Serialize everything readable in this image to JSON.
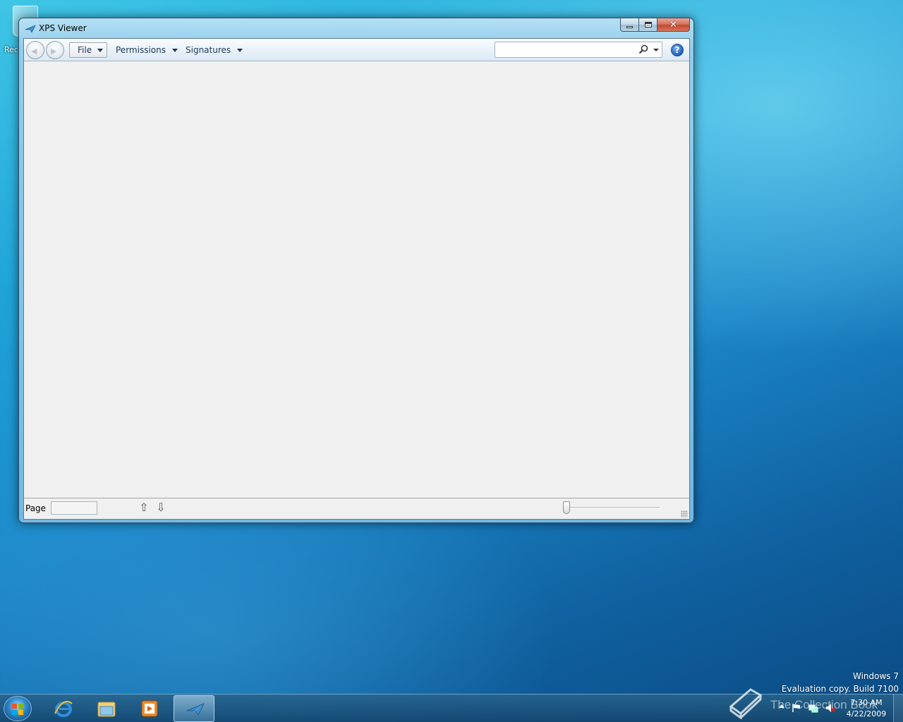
{
  "desktop": {
    "recycle_label": "Rec",
    "watermark_line1": "Windows 7",
    "watermark_line2": "Evaluation copy. Build 7100"
  },
  "window": {
    "title": "XPS Viewer",
    "icons": {
      "app": "xps-viewer-icon",
      "minimize": "minimize-icon",
      "maximize": "maximize-icon",
      "close": "close-icon"
    }
  },
  "toolbar": {
    "file_label": "File",
    "permissions_label": "Permissions",
    "signatures_label": "Signatures",
    "search": {
      "value": "",
      "placeholder": ""
    },
    "help_glyph": "?"
  },
  "statusbar": {
    "page_label": "Page",
    "page_value": ""
  },
  "taskbar": {
    "items": [
      "start-button",
      "internet-explorer",
      "windows-explorer",
      "windows-media-player",
      "xps-viewer"
    ],
    "active_item": "xps-viewer",
    "clock_time": "7:30 AM",
    "clock_date": "4/22/2009"
  },
  "overlay": {
    "logo_text": "The Collection Book"
  },
  "colors": {
    "accent": "#1e395b",
    "desktop_top": "#3fc6e6",
    "desktop_bottom": "#0b4a82",
    "close_button": "#c04a2f"
  }
}
